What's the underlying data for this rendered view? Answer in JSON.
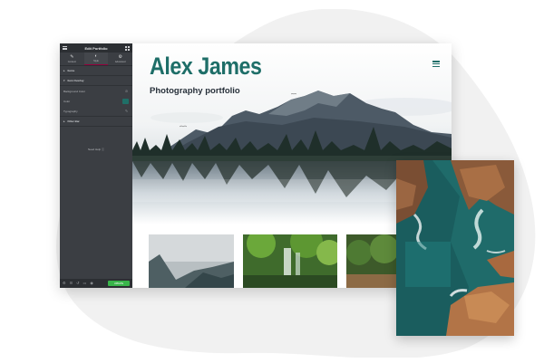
{
  "editor": {
    "title": "Edit Portfolio",
    "tabs": [
      {
        "label": "Content",
        "icon": "pencil-icon"
      },
      {
        "label": "Style",
        "icon": "half-circle-icon"
      },
      {
        "label": "Advanced",
        "icon": "gear-icon"
      }
    ],
    "sections": {
      "items": "Items",
      "item_overlay": "Item Overlay",
      "filter_bar": "Filter Bar"
    },
    "controls": {
      "background_color": "Background Color",
      "color": "Color",
      "typography": "Typography"
    },
    "need_help": "Need Help",
    "update_button": "UPDATE"
  },
  "site": {
    "title": "Alex James",
    "subtitle": "Photography portfolio"
  },
  "colors": {
    "brand": "#1e6e68",
    "panel_bg": "#3b3e43",
    "update_green": "#39b54a"
  }
}
